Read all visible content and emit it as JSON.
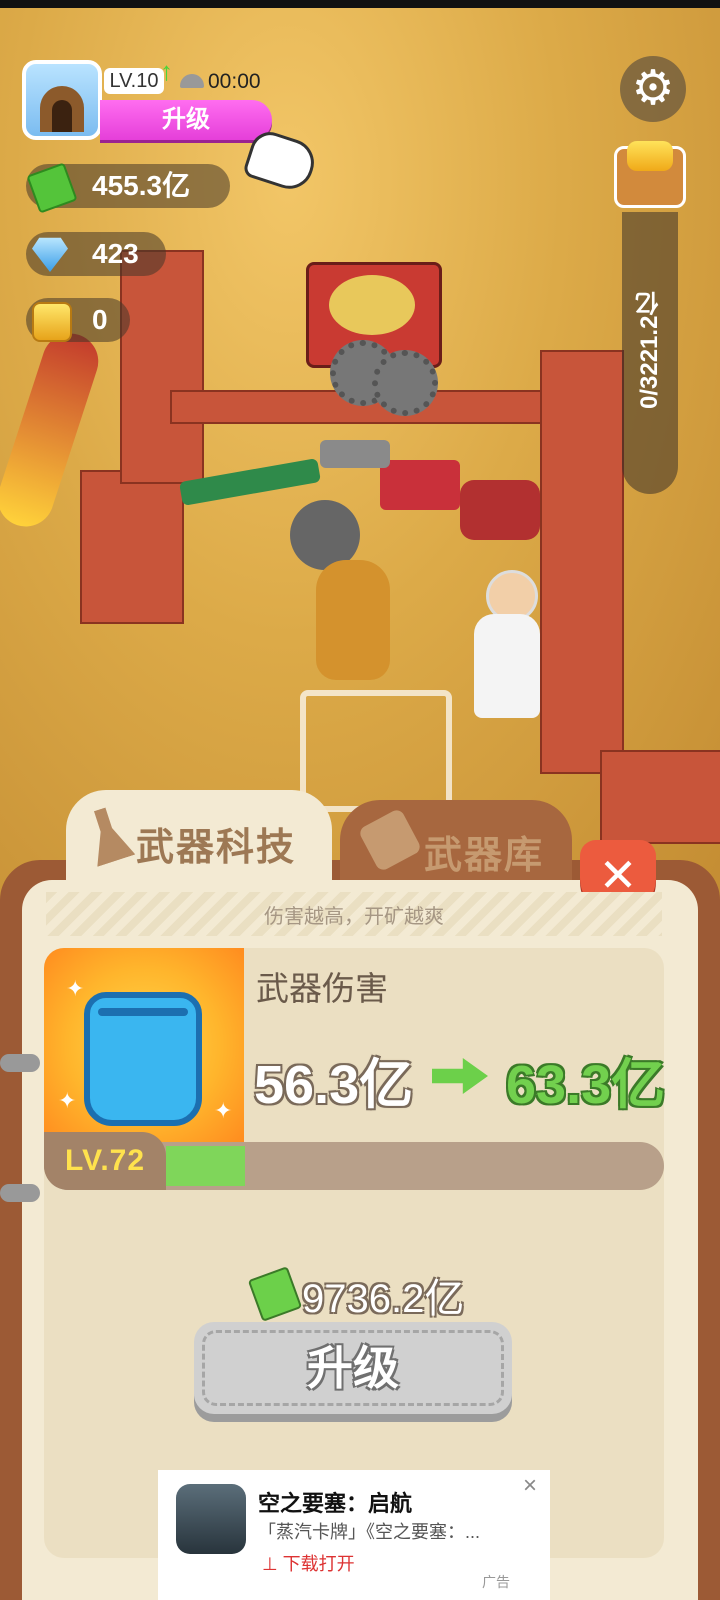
{
  "hud": {
    "level": "LV.10",
    "timer": "00:00",
    "upgrade_label": "升级",
    "cash": "455.3亿",
    "gems": "423",
    "gold": "0",
    "gold_progress": "0/3221.2亿"
  },
  "icons": {
    "settings": "gear-icon",
    "cash": "cash-icon",
    "gem": "diamond-icon",
    "gold": "gold-ore-icon"
  },
  "tabs": [
    {
      "label": "武器科技",
      "active": true
    },
    {
      "label": "武器库",
      "active": false
    }
  ],
  "panel": {
    "subtitle": "伤害越高，开矿越爽",
    "stat_name": "武器伤害",
    "current_value": "56.3亿",
    "next_value": "63.3亿",
    "level": "LV.72",
    "level_progress_fraction": 0.16,
    "cost": "9736.2亿",
    "upgrade_label": "升级"
  },
  "ad": {
    "title": "空之要塞：启航",
    "description": "「蒸汽卡牌」《空之要塞：...",
    "cta": "⊥ 下载打开",
    "tag": "广告"
  },
  "colors": {
    "accent_pink": "#e53fd9",
    "panel_brown": "#9c5a35",
    "upgrade_green": "#72d04e",
    "close_red": "#ec5b3e"
  }
}
